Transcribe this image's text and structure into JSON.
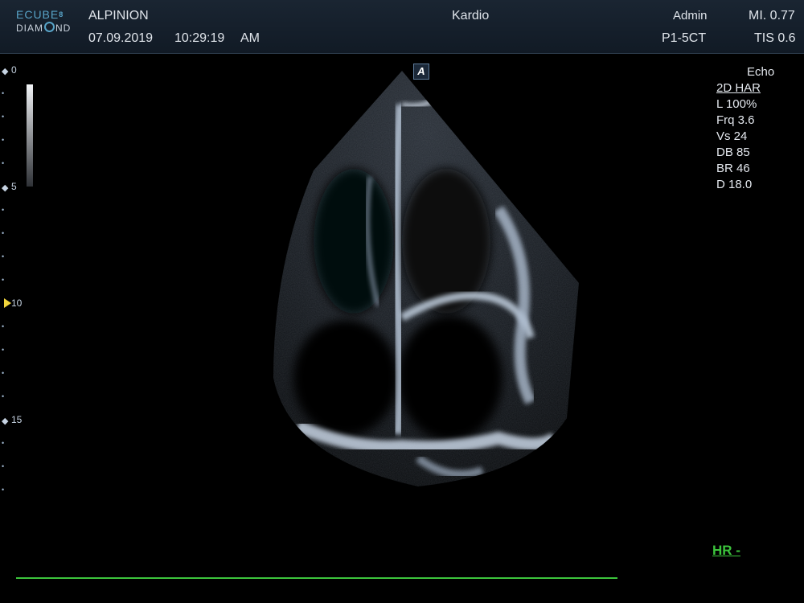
{
  "header": {
    "logo_line1": "ECUBE",
    "logo_line1_sup": "8",
    "logo_line2_a": "DIAM",
    "logo_line2_b": "ND",
    "brand": "ALPINION",
    "date": "07.09.2019",
    "time": "10:29:19",
    "ampm": "AM",
    "preset": "Kardio",
    "user": "Admin",
    "probe": "P1-5CT",
    "mi": "MI. 0.77",
    "tis": "TIS 0.6"
  },
  "depth_scale": {
    "labels": [
      "0",
      "5",
      "10",
      "15"
    ],
    "marker": "◆"
  },
  "orientation_marker": "A",
  "params": {
    "exam": "Echo",
    "mode": "2D HAR",
    "power": "L 100%",
    "frequency": "Frq 3.6",
    "vs": "Vs 24",
    "dynamic_range": "DB 85",
    "brightness": "BR 46",
    "depth": "D 18.0"
  },
  "hr_label": "HR -",
  "colors": {
    "ecg": "#3cc43c",
    "focus": "#f2d53c",
    "accent": "#58a4c8"
  }
}
